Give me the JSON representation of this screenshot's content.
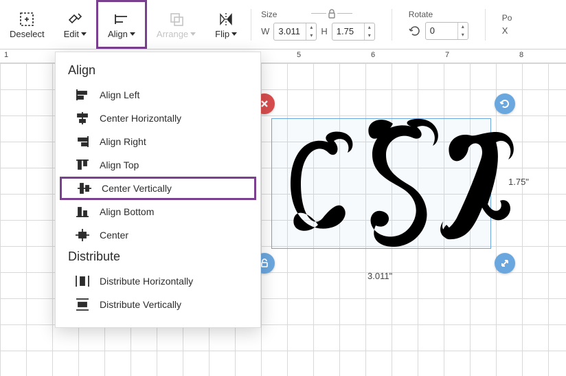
{
  "toolbar": {
    "deselect": "Deselect",
    "edit": "Edit",
    "align": "Align",
    "arrange": "Arrange",
    "flip": "Flip"
  },
  "props": {
    "size_label": "Size",
    "w_label": "W",
    "w_value": "3.011",
    "h_label": "H",
    "h_value": "1.75",
    "rotate_label": "Rotate",
    "rotate_value": "0",
    "position_label": "Po",
    "position_x": "X"
  },
  "dropdown": {
    "align_header": "Align",
    "distribute_header": "Distribute",
    "items": {
      "align_left": "Align Left",
      "center_h": "Center Horizontally",
      "align_right": "Align Right",
      "align_top": "Align Top",
      "center_v": "Center Vertically",
      "align_bottom": "Align Bottom",
      "center": "Center",
      "dist_h": "Distribute Horizontally",
      "dist_v": "Distribute Vertically"
    }
  },
  "ruler": {
    "t1": "1",
    "t5": "5",
    "t6": "6",
    "t7": "7",
    "t8": "8"
  },
  "canvas": {
    "width_label": "3.011\"",
    "height_label": "1.75\"",
    "letters": {
      "c": "C",
      "s": "S",
      "l": "L"
    }
  }
}
